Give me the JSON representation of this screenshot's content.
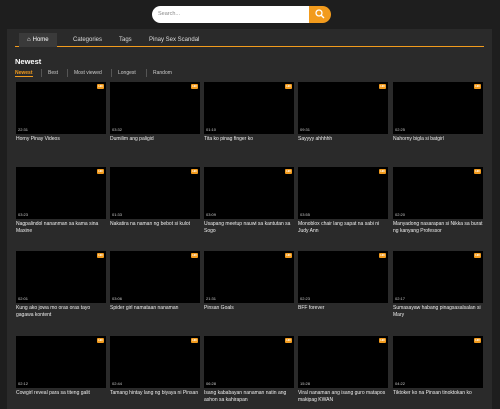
{
  "search": {
    "placeholder": "Search..."
  },
  "nav": {
    "home": "Home",
    "categories": "Categories",
    "tags": "Tags",
    "pinay": "Pinay Sex Scandal"
  },
  "section_title": "Newest",
  "sort": {
    "newest": "Newest",
    "best": "Best",
    "most_viewed": "Most viewed",
    "longest": "Longest",
    "random": "Random"
  },
  "hd_badge": "HD",
  "videos": [
    {
      "duration": "22:31",
      "title": "Horny Pinay Videos"
    },
    {
      "duration": "03:32",
      "title": "Dumilim ang paligid"
    },
    {
      "duration": "01:10",
      "title": "Tita ko pinag finger ko"
    },
    {
      "duration": "09:31",
      "title": "Sayyyy ahhhhh"
    },
    {
      "duration": "02:25",
      "title": "Nahorny bigla si batgirl"
    },
    {
      "duration": "03:23",
      "title": "Nagpalindol nananman sa kama sina Maxine"
    },
    {
      "duration": "01:33",
      "title": "Nakatira na naman ng bebot si kulot"
    },
    {
      "duration": "03:09",
      "title": "Usapang meetup nauwi sa kantutan sa Sogo"
    },
    {
      "duration": "03:55",
      "title": "Monoblox chair lang sapat na sabi ni Judy Ann"
    },
    {
      "duration": "02:20",
      "title": "Manyadong nasarapan si Nikka sa burat ng kanyang Professor"
    },
    {
      "duration": "02:01",
      "title": "Kung ako jowa mo oras oras tayo gagawa kontent"
    },
    {
      "duration": "03:06",
      "title": "Spider girl namataan nanaman"
    },
    {
      "duration": "21:31",
      "title": "Pinsan Goals"
    },
    {
      "duration": "02:23",
      "title": "BFF forever"
    },
    {
      "duration": "02:17",
      "title": "Sumasayaw habang pinagsasalsalan si Mary"
    },
    {
      "duration": "02:12",
      "title": "Cowgirl reveal para sa titeng galit"
    },
    {
      "duration": "02:44",
      "title": "Tamang hintay lang ng biyaya ni Pinsan"
    },
    {
      "duration": "06:28",
      "title": "Isang kababayan nanaman natin ang ashon sa kahirapan"
    },
    {
      "duration": "15:28",
      "title": "Viral nanaman ang isang guro matapos makipag KWAN"
    },
    {
      "duration": "04:22",
      "title": "Tiktoker ko na Pinsan tinoktokan ko"
    }
  ]
}
